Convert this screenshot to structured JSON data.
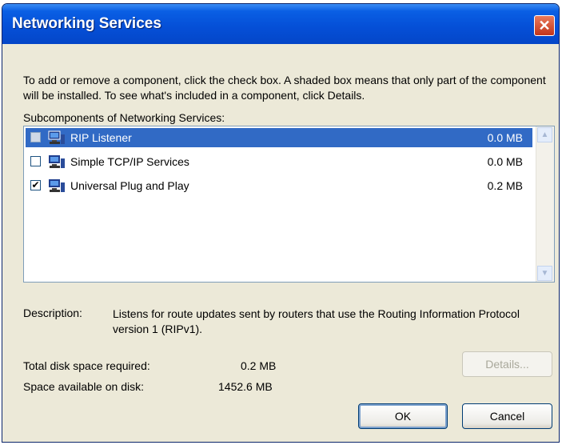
{
  "window": {
    "title": "Networking Services"
  },
  "intro_text": "To add or remove a component, click the check box. A shaded box means that only part of the component will be installed. To see what's included in a component, click Details.",
  "subcomponents_label": "Subcomponents of Networking Services:",
  "components": [
    {
      "name": "RIP Listener",
      "size": "0.0 MB",
      "state": "shaded",
      "selected": true
    },
    {
      "name": "Simple TCP/IP Services",
      "size": "0.0 MB",
      "state": "unchecked",
      "selected": false
    },
    {
      "name": "Universal Plug and Play",
      "size": "0.2 MB",
      "state": "checked",
      "selected": false
    }
  ],
  "description": {
    "label": "Description:",
    "text": "Listens for route updates sent by routers that use the Routing Information Protocol version 1 (RIPv1)."
  },
  "disk": {
    "required_label": "Total disk space required:",
    "required_value": "0.2 MB",
    "available_label": "Space available on disk:",
    "available_value": "1452.6 MB"
  },
  "buttons": {
    "details": "Details...",
    "ok": "OK",
    "cancel": "Cancel"
  },
  "icons": {
    "close": "close-icon",
    "network": "network-computer-icon",
    "scroll_up": "chevron-up-icon",
    "scroll_down": "chevron-down-icon"
  }
}
